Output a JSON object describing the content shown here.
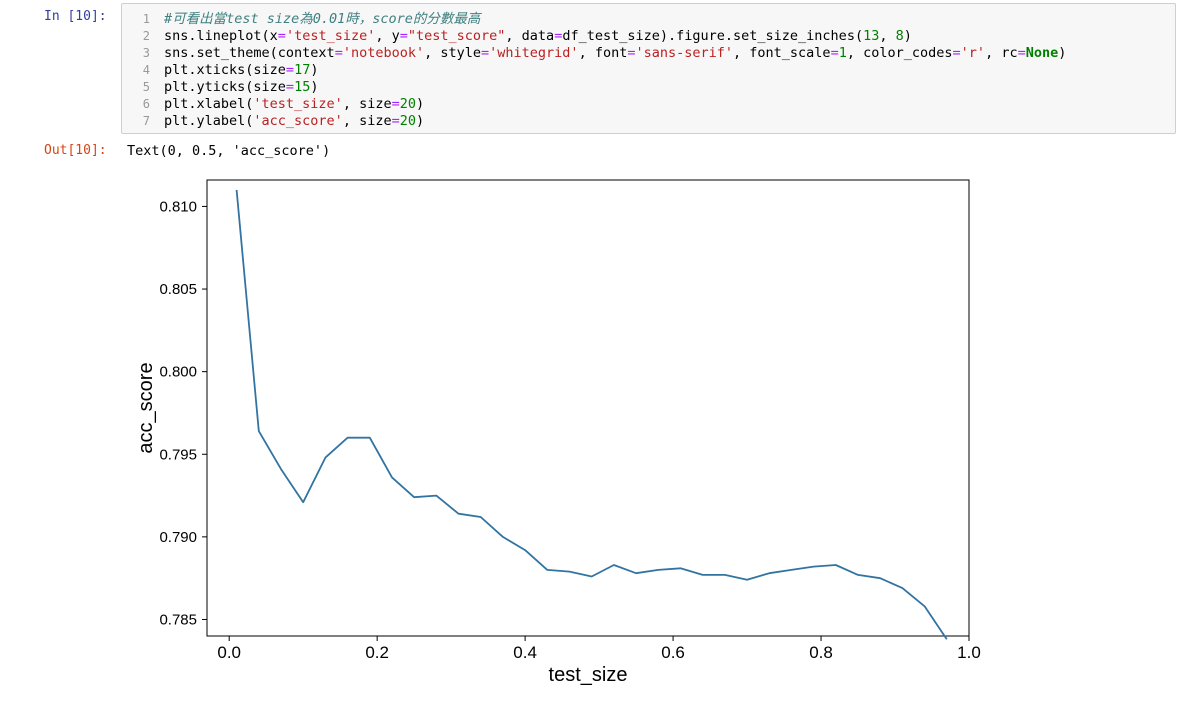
{
  "input_prompt": "In [10]:",
  "output_prompt": "Out[10]:",
  "code_lines": [
    {
      "n": "1",
      "parts": [
        [
          "cm",
          "#可看出當test size為0.01時，score的分數最高"
        ]
      ]
    },
    {
      "n": "2",
      "parts": [
        [
          "",
          "sns.lineplot(x"
        ],
        [
          "op",
          "="
        ],
        [
          "st",
          "'test_size'"
        ],
        [
          "",
          ", y"
        ],
        [
          "op",
          "="
        ],
        [
          "st",
          "\"test_score\""
        ],
        [
          "",
          ", data"
        ],
        [
          "op",
          "="
        ],
        [
          "",
          "df_test_size).figure.set_size_inches("
        ],
        [
          "nm",
          "13"
        ],
        [
          "",
          ", "
        ],
        [
          "nm",
          "8"
        ],
        [
          "",
          ")"
        ]
      ]
    },
    {
      "n": "3",
      "parts": [
        [
          "",
          "sns.set_theme(context"
        ],
        [
          "op",
          "="
        ],
        [
          "st",
          "'notebook'"
        ],
        [
          "",
          ", style"
        ],
        [
          "op",
          "="
        ],
        [
          "st",
          "'whitegrid'"
        ],
        [
          "",
          ", font"
        ],
        [
          "op",
          "="
        ],
        [
          "st",
          "'sans-serif'"
        ],
        [
          "",
          ", font_scale"
        ],
        [
          "op",
          "="
        ],
        [
          "nm",
          "1"
        ],
        [
          "",
          ", color_codes"
        ],
        [
          "op",
          "="
        ],
        [
          "st",
          "'r'"
        ],
        [
          "",
          ", rc"
        ],
        [
          "op",
          "="
        ],
        [
          "kw",
          "None"
        ],
        [
          "",
          ")"
        ]
      ]
    },
    {
      "n": "4",
      "parts": [
        [
          "",
          "plt.xticks(size"
        ],
        [
          "op",
          "="
        ],
        [
          "nm",
          "17"
        ],
        [
          "",
          ")"
        ]
      ]
    },
    {
      "n": "5",
      "parts": [
        [
          "",
          "plt.yticks(size"
        ],
        [
          "op",
          "="
        ],
        [
          "nm",
          "15"
        ],
        [
          "",
          ")"
        ]
      ]
    },
    {
      "n": "6",
      "parts": [
        [
          "",
          "plt.xlabel("
        ],
        [
          "st",
          "'test_size'"
        ],
        [
          "",
          ", size"
        ],
        [
          "op",
          "="
        ],
        [
          "nm",
          "20"
        ],
        [
          "",
          ")"
        ]
      ]
    },
    {
      "n": "7",
      "parts": [
        [
          "",
          "plt.ylabel("
        ],
        [
          "st",
          "'acc_score'"
        ],
        [
          "",
          ", size"
        ],
        [
          "op",
          "="
        ],
        [
          "nm",
          "20"
        ],
        [
          "",
          ")"
        ]
      ]
    }
  ],
  "output_text": "Text(0, 0.5, 'acc_score')",
  "colors": {
    "line": "#3274a1",
    "axes": "#000000"
  },
  "chart_data": {
    "type": "line",
    "xlabel": "test_size",
    "ylabel": "acc_score",
    "xlim": [
      -0.03,
      1.0
    ],
    "ylim": [
      0.784,
      0.8116
    ],
    "xticks": [
      0.0,
      0.2,
      0.4,
      0.6,
      0.8,
      1.0
    ],
    "xtick_labels": [
      "0.0",
      "0.2",
      "0.4",
      "0.6",
      "0.8",
      "1.0"
    ],
    "yticks": [
      0.785,
      0.79,
      0.795,
      0.8,
      0.805,
      0.81
    ],
    "ytick_labels": [
      "0.785",
      "0.790",
      "0.795",
      "0.800",
      "0.805",
      "0.810"
    ],
    "series": [
      {
        "x": [
          0.01,
          0.04,
          0.07,
          0.1,
          0.13,
          0.16,
          0.19,
          0.22,
          0.25,
          0.28,
          0.31,
          0.34,
          0.37,
          0.4,
          0.43,
          0.46,
          0.49,
          0.52,
          0.55,
          0.58,
          0.61,
          0.64,
          0.67,
          0.7,
          0.73,
          0.76,
          0.79,
          0.82,
          0.85,
          0.88,
          0.91,
          0.94,
          0.97
        ],
        "y": [
          0.811,
          0.7964,
          0.7941,
          0.7921,
          0.7948,
          0.796,
          0.796,
          0.7936,
          0.7924,
          0.7925,
          0.7914,
          0.7912,
          0.79,
          0.7892,
          0.788,
          0.7879,
          0.7876,
          0.7883,
          0.7878,
          0.788,
          0.7881,
          0.7877,
          0.7877,
          0.7874,
          0.7878,
          0.788,
          0.7882,
          0.7883,
          0.7877,
          0.7875,
          0.7869,
          0.7858,
          0.7838
        ]
      }
    ]
  }
}
